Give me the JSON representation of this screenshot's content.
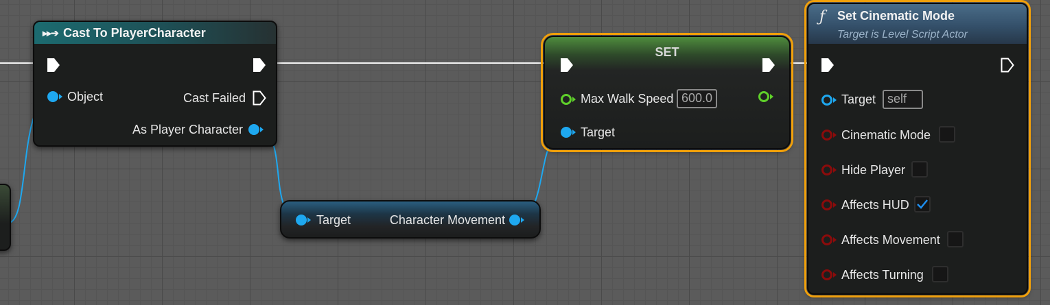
{
  "cast_node": {
    "title": "Cast To PlayerCharacter",
    "object_label": "Object",
    "cast_failed_label": "Cast Failed",
    "as_player_label": "As Player Character"
  },
  "get_node": {
    "target_label": "Target",
    "output_label": "Character Movement"
  },
  "set_node": {
    "title": "SET",
    "max_walk_speed_label": "Max Walk Speed",
    "max_walk_speed_value": "600.0",
    "target_label": "Target"
  },
  "cinematic_node": {
    "function_icon": "ƒ",
    "title": "Set Cinematic Mode",
    "subtitle": "Target is Level Script Actor",
    "target_label": "Target",
    "target_value": "self",
    "params": [
      {
        "label": "Cinematic Mode",
        "checked": false
      },
      {
        "label": "Hide Player",
        "checked": false
      },
      {
        "label": "Affects HUD",
        "checked": true
      },
      {
        "label": "Affects Movement",
        "checked": false
      },
      {
        "label": "Affects Turning",
        "checked": false
      }
    ]
  },
  "colors": {
    "exec": "#ffffff",
    "object_pin": "#1ea8f0",
    "float_pin": "#5fd02a",
    "bool_pin": "#8c0b0b",
    "selection": "#f1a00a",
    "cast_header": "#1c5c63",
    "set_header": "#4e8a3c",
    "function_header": "#3d5a73"
  }
}
